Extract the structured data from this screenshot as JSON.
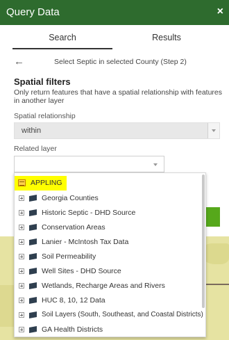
{
  "header": {
    "title": "Query Data",
    "close_label": "×"
  },
  "tabs": [
    {
      "label": "Search"
    },
    {
      "label": "Results"
    }
  ],
  "step": {
    "back_icon": "←",
    "label": "Select Septic in selected County (Step 2)"
  },
  "spatial_filters": {
    "title": "Spatial filters",
    "description": "Only return features that have a spatial relationship with features in another layer",
    "relationship_label": "Spatial relationship",
    "relationship_value": "within",
    "related_layer_label": "Related layer",
    "related_layer_value": ""
  },
  "dropdown": {
    "selected": {
      "label": "APPLING"
    },
    "items": [
      {
        "label": "Georgia Counties"
      },
      {
        "label": "Historic Septic - DHD Source"
      },
      {
        "label": "Conservation Areas"
      },
      {
        "label": "Lanier - McIntosh Tax Data"
      },
      {
        "label": "Soil Permeability"
      },
      {
        "label": "Well Sites - DHD Source"
      },
      {
        "label": "Wetlands, Recharge Areas and Rivers"
      },
      {
        "label": "HUC 8, 10, 12 Data"
      },
      {
        "label": "Soil Layers (South, Southeast, and Coastal Districts)"
      },
      {
        "label": "GA Health Districts"
      }
    ]
  },
  "colors": {
    "header_bg": "#2e6b2e",
    "selected_highlight": "#ffff00",
    "apply_button": "#56a81b",
    "map_bg": "#e6e3a2"
  },
  "icons": [
    "close-icon",
    "back-arrow-icon",
    "chevron-down-icon",
    "expand-icon",
    "layer-icon",
    "table-icon"
  ]
}
